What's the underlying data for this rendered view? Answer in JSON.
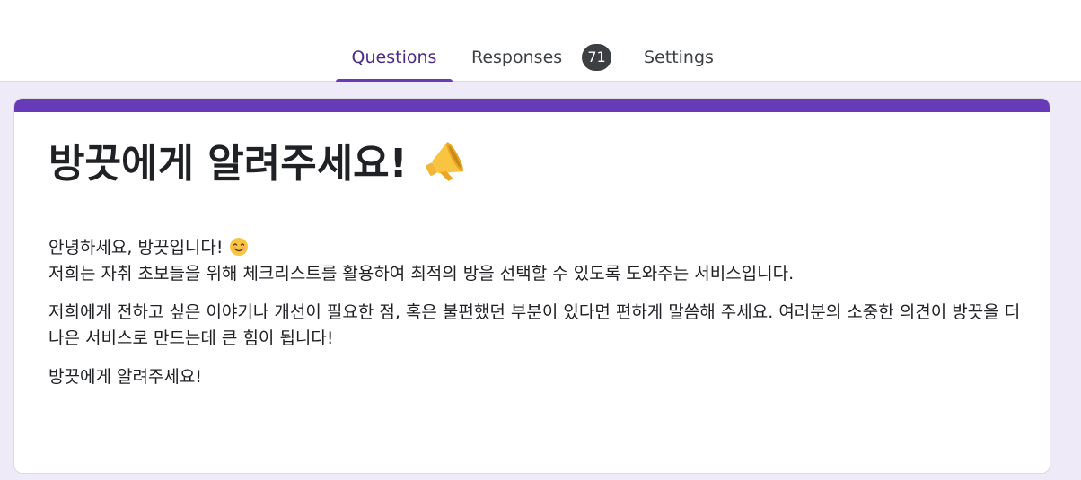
{
  "tabs": {
    "questions_label": "Questions",
    "responses_label": "Responses",
    "responses_count": "71",
    "settings_label": "Settings"
  },
  "form": {
    "title": "방끗에게 알려주세요!",
    "title_icon": "megaphone-icon",
    "description": {
      "line1": "안녕하세요, 방끗입니다!",
      "line1_icon": "smiling-face-icon",
      "line2": "저희는 자취 초보들을 위해 체크리스트를 활용하여 최적의 방을 선택할 수 있도록 도와주는 서비스입니다.",
      "paragraph2": "저희에게 전하고 싶은 이야기나 개선이 필요한 점, 혹은 불편했던 부분이 있다면 편하게 말씀해 주세요. 여러분의 소중한 의견이 방끗을 더 나은 서비스로 만드는데 큰 힘이 됩니다!",
      "paragraph3": "방끗에게 알려주세요!"
    }
  },
  "colors": {
    "accent": "#673ab7",
    "background": "#efeaf8",
    "badge": "#3c4043"
  }
}
